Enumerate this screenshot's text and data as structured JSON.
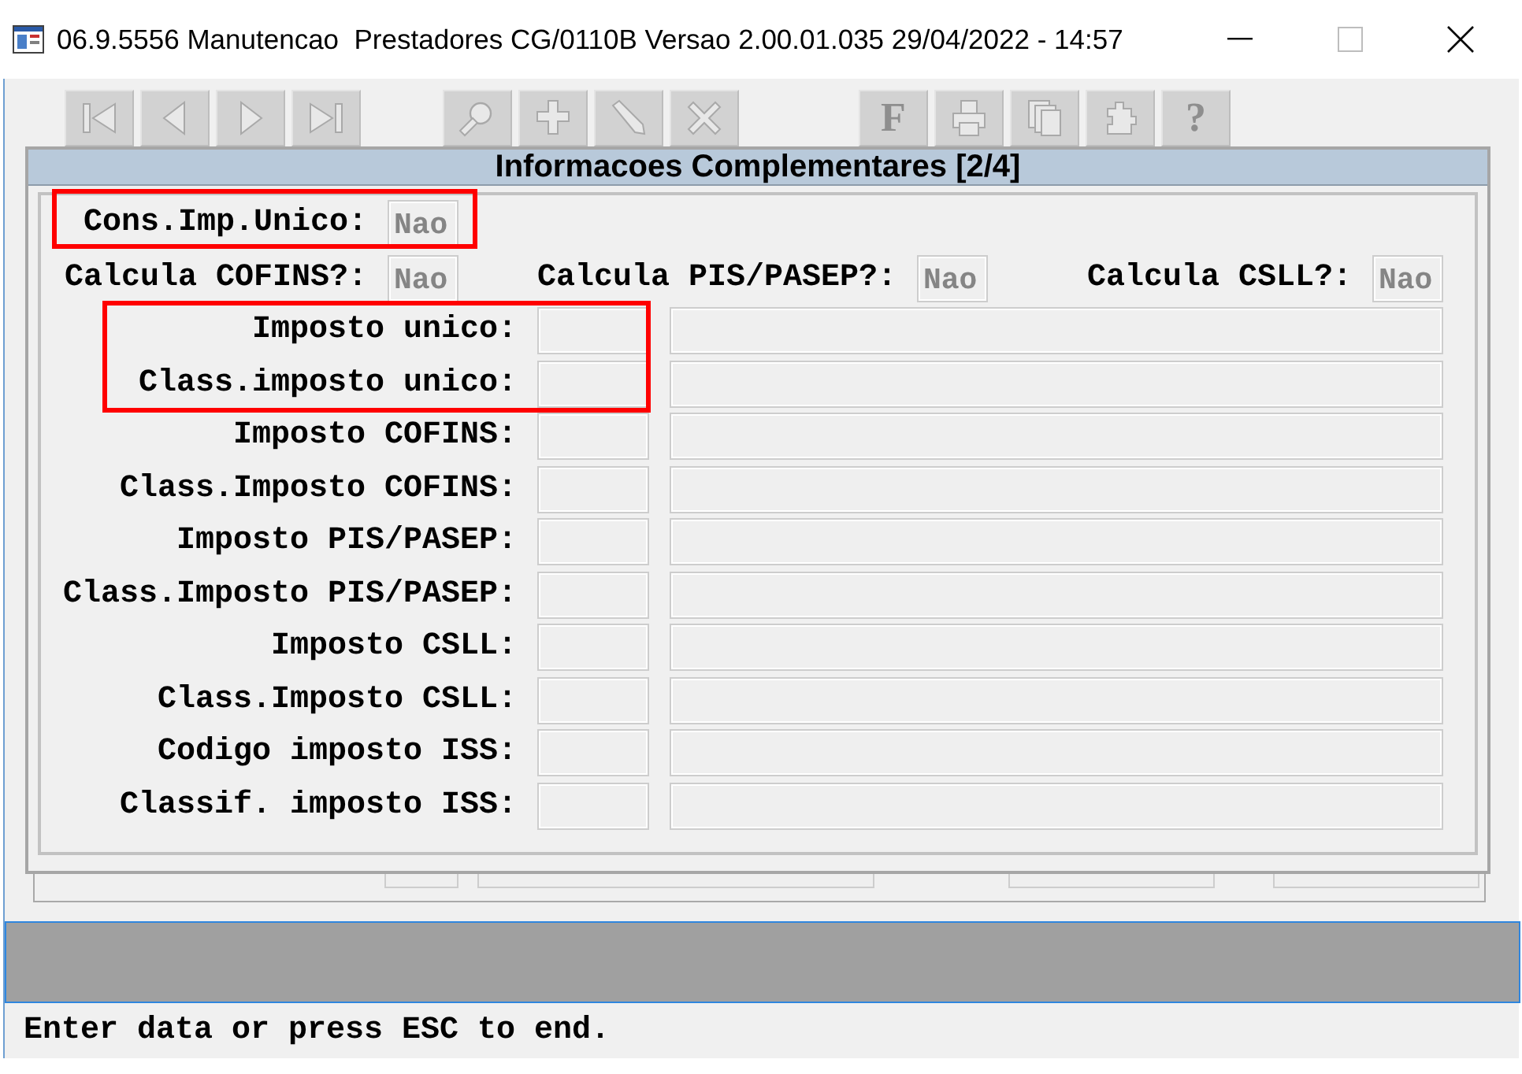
{
  "window": {
    "title": "06.9.5556 Manutencao  Prestadores CG/0110B Versao 2.00.01.035 29/04/2022 - 14:57"
  },
  "toolbar": {
    "groups": [
      {
        "buttons": [
          {
            "kind": "first",
            "disabled": true
          },
          {
            "kind": "previous",
            "disabled": true
          },
          {
            "kind": "next",
            "disabled": true
          },
          {
            "kind": "last",
            "disabled": true
          }
        ]
      },
      {
        "buttons": [
          {
            "kind": "search",
            "disabled": true
          },
          {
            "kind": "add",
            "disabled": true
          },
          {
            "kind": "edit",
            "disabled": true
          },
          {
            "kind": "delete",
            "disabled": true
          }
        ]
      },
      {
        "buttons": [
          {
            "kind": "glyph",
            "glyph": "F",
            "disabled": true
          },
          {
            "kind": "print",
            "disabled": true
          },
          {
            "kind": "copy",
            "disabled": true
          },
          {
            "kind": "tools",
            "disabled": true
          },
          {
            "kind": "glyph",
            "glyph": "?",
            "disabled": true
          }
        ]
      }
    ]
  },
  "dialog": {
    "title": "Informacoes Complementares [2/4]",
    "option_rows": [
      {
        "options": [
          {
            "label": "Cons.Imp.Unico:",
            "value": "Nao",
            "highlighted": true
          }
        ]
      },
      {
        "options": [
          {
            "label": "Calcula COFINS?:",
            "value": "Nao",
            "highlighted": false
          },
          {
            "label": "Calcula PIS/PASEP?:",
            "value": "Nao",
            "highlighted": false
          },
          {
            "label": "Calcula CSLL?:",
            "value": "Nao",
            "highlighted": false
          }
        ]
      }
    ],
    "detail_rows": [
      {
        "label": "Imposto unico:",
        "highlighted": true
      },
      {
        "label": "Class.imposto unico:",
        "highlighted": true
      },
      {
        "label": "Imposto COFINS:",
        "highlighted": false
      },
      {
        "label": "Class.Imposto COFINS:",
        "highlighted": false
      },
      {
        "label": "Imposto PIS/PASEP:",
        "highlighted": false
      },
      {
        "label": "Class.Imposto PIS/PASEP:",
        "highlighted": false
      },
      {
        "label": "Imposto CSLL:",
        "highlighted": false
      },
      {
        "label": "Class.Imposto CSLL:",
        "highlighted": false
      },
      {
        "label": "Codigo imposto ISS:",
        "highlighted": false
      },
      {
        "label": "Classif. imposto ISS:",
        "highlighted": false
      }
    ]
  },
  "status_bar": {
    "text": "Enter data or press ESC to end."
  }
}
